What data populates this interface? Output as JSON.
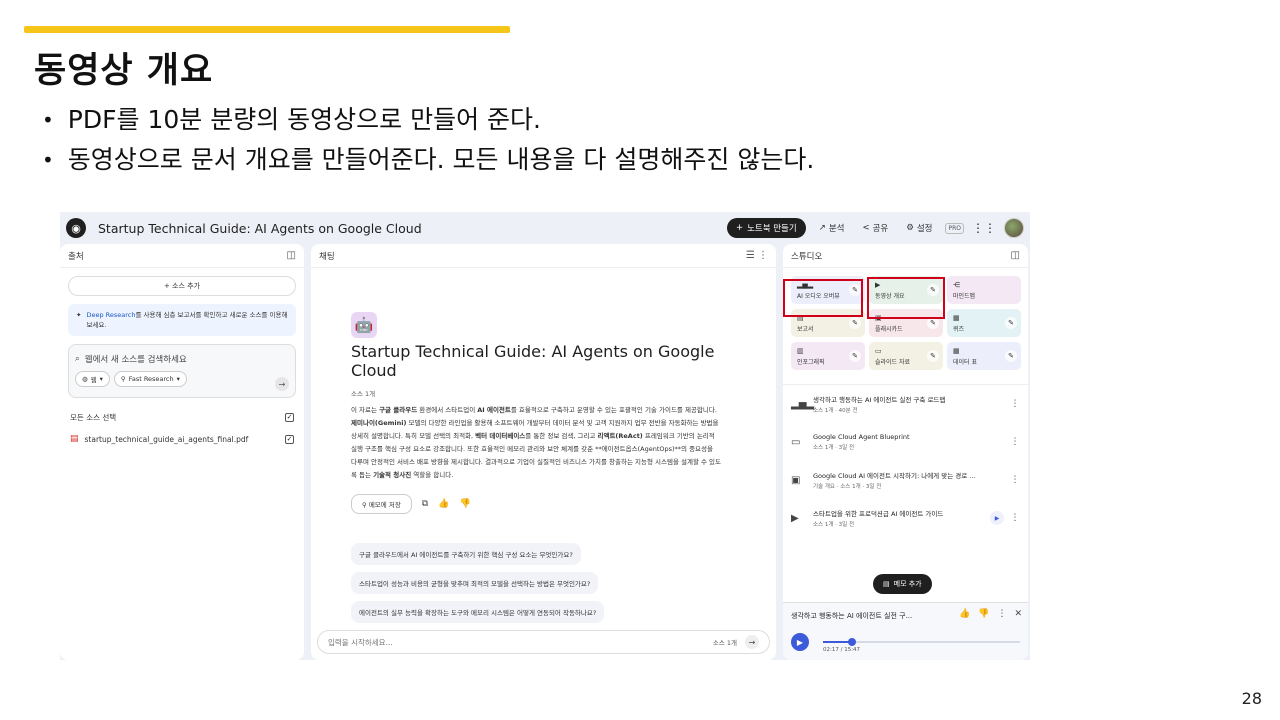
{
  "slide": {
    "title": "동영상 개요",
    "bullets": [
      "PDF를 10분 분량의 동영상으로 만들어 준다.",
      "동영상으로 문서 개요를 만들어준다. 모든 내용을 다 설명해주진 않는다."
    ],
    "page_number": "28",
    "accent_color": "#f5c518",
    "highlight_color": "#d0021b"
  },
  "app": {
    "notebook_title": "Startup Technical Guide: AI Agents on Google Cloud",
    "top": {
      "create_notebook": "노트북 만들기",
      "analytics": "분석",
      "share": "공유",
      "settings": "설정",
      "pro": "PRO"
    },
    "sources": {
      "header": "출처",
      "add_source": "소스 추가",
      "deep_research_link": "Deep Research",
      "deep_research_text": "를 사용해 심층 보고서를 확인하고 새로운 소스를 이용해 보세요.",
      "search_placeholder": "웹에서 새 소스를 검색하세요",
      "chip_web": "웹",
      "chip_fast": "Fast Research",
      "select_all": "모든 소스 선택",
      "file_name": "startup_technical_guide_ai_agents_final.pdf"
    },
    "chat": {
      "header": "채팅",
      "title": "Startup Technical Guide: AI Agents on Google Cloud",
      "source_count": "소스 1개",
      "summary_parts": [
        {
          "t": "이 자료는 ",
          "b": false
        },
        {
          "t": "구글 클라우드",
          "b": true
        },
        {
          "t": " 환경에서 스타트업이 ",
          "b": false
        },
        {
          "t": "AI 에이전트",
          "b": true
        },
        {
          "t": "를 효율적으로 구축하고 운영할 수 있는 포괄적인 기술 가이드를 제공합니다. ",
          "b": false
        },
        {
          "t": "제미나이(Gemini)",
          "b": true
        },
        {
          "t": " 모델의 다양한 라인업을 활용해 소프트웨어 개발부터 데이터 분석 및 고객 지원까지 업무 전반을 자동화하는 방법을 상세히 설명합니다. 특히 모델 선택의 최적화, ",
          "b": false
        },
        {
          "t": "벡터 데이터베이스",
          "b": true
        },
        {
          "t": "를 통한 정보 검색, 그리고 ",
          "b": false
        },
        {
          "t": "리액트(ReAct)",
          "b": true
        },
        {
          "t": " 프레임워크 기반의 논리적 실행 구조를 핵심 구성 요소로 강조합니다. 또한 효율적인 메모리 관리와 보안 체계를 갖춘 **에이전트옵스(AgentOps)**의 중요성을 다루며 안정적인 서비스 배포 방향을 제시합니다. 결과적으로 기업이 실질적인 비즈니스 가치를 창출하는 지능형 시스템을 설계할 수 있도록 돕는 ",
          "b": false
        },
        {
          "t": "기술적 청사진",
          "b": true
        },
        {
          "t": " 역할을 합니다.",
          "b": false
        }
      ],
      "save_memo": "메모에 저장",
      "suggestions": [
        "구글 클라우드에서 AI 에이전트를 구축하기 위한 핵심 구성 요소는 무엇인가요?",
        "스타트업이 성능과 비용의 균형을 맞추며 최적의 모델을 선택하는 방법은 무엇인가요?",
        "에이전트의 실무 능력을 확장하는 도구와 메모리 시스템은 어떻게 연동되어 작동하나요?"
      ],
      "input_placeholder": "입력을 시작하세요...",
      "input_count": "소스 1개"
    },
    "studio": {
      "header": "스튜디오",
      "tiles": [
        {
          "label": "AI 오디오 오버뷰",
          "icon": "▂▅▂",
          "bg": "#eceefb"
        },
        {
          "label": "동영상 개요",
          "icon": "▶",
          "bg": "#e6f2e9"
        },
        {
          "label": "마인드맵",
          "icon": "⋲",
          "bg": "#f3e8f3"
        },
        {
          "label": "보고서",
          "icon": "▤",
          "bg": "#f3f1e4"
        },
        {
          "label": "플래시카드",
          "icon": "▣",
          "bg": "#f7e7ea"
        },
        {
          "label": "퀴즈",
          "icon": "▦",
          "bg": "#e3f2f4"
        },
        {
          "label": "인포그래픽",
          "icon": "▥",
          "bg": "#f3e8f3"
        },
        {
          "label": "슬라이드 자료",
          "icon": "▭",
          "bg": "#f3f1e4"
        },
        {
          "label": "데이터 표",
          "icon": "▦",
          "bg": "#eceefb"
        }
      ],
      "outputs": [
        {
          "title": "생각하고 행동하는 AI 에이전트 실전 구축 로드맵",
          "meta": "소스 1개 · 40분 전",
          "icon": "▂▅▂"
        },
        {
          "title": "Google Cloud Agent Blueprint",
          "meta": "소스 1개 · 3일 전",
          "icon": "▭"
        },
        {
          "title": "Google Cloud AI 에이전트 시작하기: 나에게 맞는 경로 ...",
          "meta": "기술 개요 · 소스 1개 · 3일 전",
          "icon": "▣"
        },
        {
          "title": "스타트업을 위한 프로덕션급 AI 에이전트 가이드",
          "meta": "소스 1개 · 3일 전",
          "icon": "▶"
        }
      ],
      "add_note": "메모 추가",
      "player_title": "생각하고 행동하는 AI 에이전트 실전 구...",
      "player_time": "02:17 / 15:47",
      "player_progress": 0.145
    }
  }
}
